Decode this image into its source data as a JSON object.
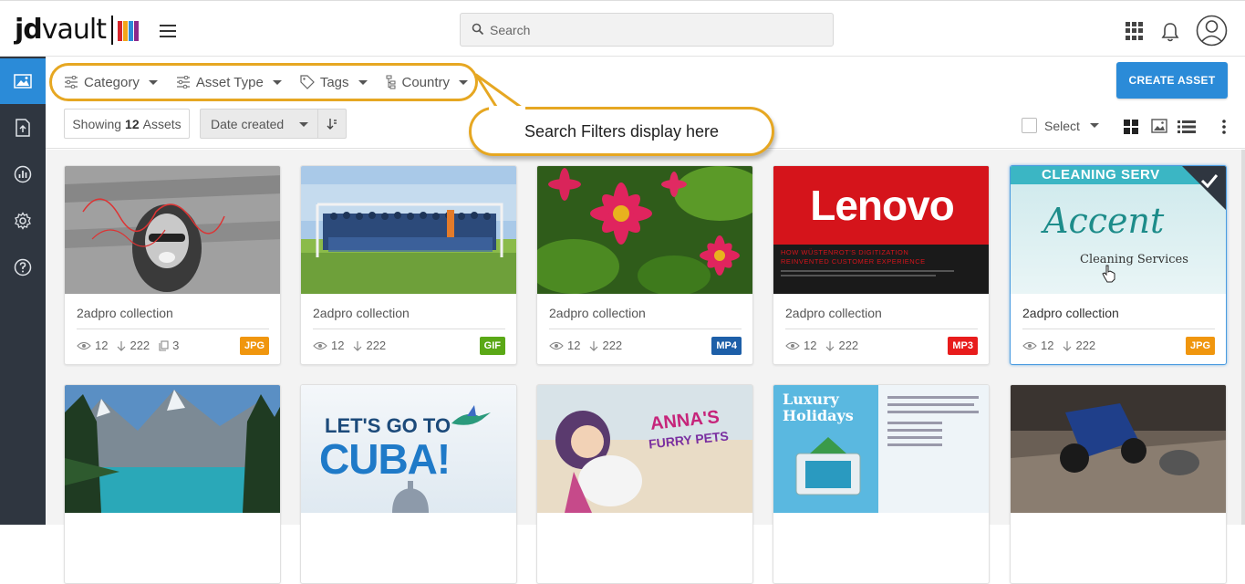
{
  "header": {
    "logo": {
      "part1": "jd",
      "part2": "vault",
      "mark_colors": [
        "#d6262c",
        "#f2a51a",
        "#2b8bd8",
        "#8c2a8b"
      ]
    },
    "search_placeholder": "Search"
  },
  "sidebar": {
    "items": [
      {
        "name": "images",
        "active": true
      },
      {
        "name": "upload",
        "active": false
      },
      {
        "name": "analytics",
        "active": false
      },
      {
        "name": "settings",
        "active": false
      },
      {
        "name": "help",
        "active": false
      }
    ]
  },
  "filters": {
    "items": [
      {
        "label": "Category",
        "icon": "sliders-icon"
      },
      {
        "label": "Asset Type",
        "icon": "sliders-icon"
      },
      {
        "label": "Tags",
        "icon": "tag-icon"
      },
      {
        "label": "Country",
        "icon": "tree-icon"
      }
    ]
  },
  "toolbar": {
    "create_label": "CREATE ASSET",
    "showing_prefix": "Showing",
    "showing_count": "12",
    "showing_suffix": "Assets",
    "sort_label": "Date created",
    "select_label": "Select"
  },
  "callout": {
    "text": "Search Filters display here"
  },
  "cards": [
    {
      "title": "2adpro collection",
      "views": "12",
      "downloads": "222",
      "copies": "3",
      "badge": "JPG",
      "badge_color": "#f0960e",
      "selected": false
    },
    {
      "title": "2adpro collection",
      "views": "12",
      "downloads": "222",
      "badge": "GIF",
      "badge_color": "#5aa816",
      "selected": false
    },
    {
      "title": "2adpro collection",
      "views": "12",
      "downloads": "222",
      "badge": "MP4",
      "badge_color": "#1d5fa8",
      "selected": false
    },
    {
      "title": "2adpro collection",
      "views": "12",
      "downloads": "222",
      "badge": "MP3",
      "badge_color": "#e81c1c",
      "selected": false
    },
    {
      "title": "2adpro collection",
      "views": "12",
      "downloads": "222",
      "badge": "JPG",
      "badge_color": "#f0960e",
      "selected": true
    }
  ],
  "thumb_text": {
    "lenovo": "Lenovo",
    "lenovo_sub1": "HOW WÜSTENROT'S DIGITIZATION",
    "lenovo_sub2": "REINVENTED CUSTOMER EXPERIENCE",
    "accent_top": "CLEANING SERV",
    "accent_main": "Accent",
    "accent_sub": "Cleaning Services",
    "cuba_line1": "LET'S GO TO",
    "cuba_line2": "CUBA!",
    "anna_line1": "ANNA'S",
    "anna_line2": "FURRY PETS",
    "luxury_line1": "Luxury",
    "luxury_line2": "Holidays"
  }
}
